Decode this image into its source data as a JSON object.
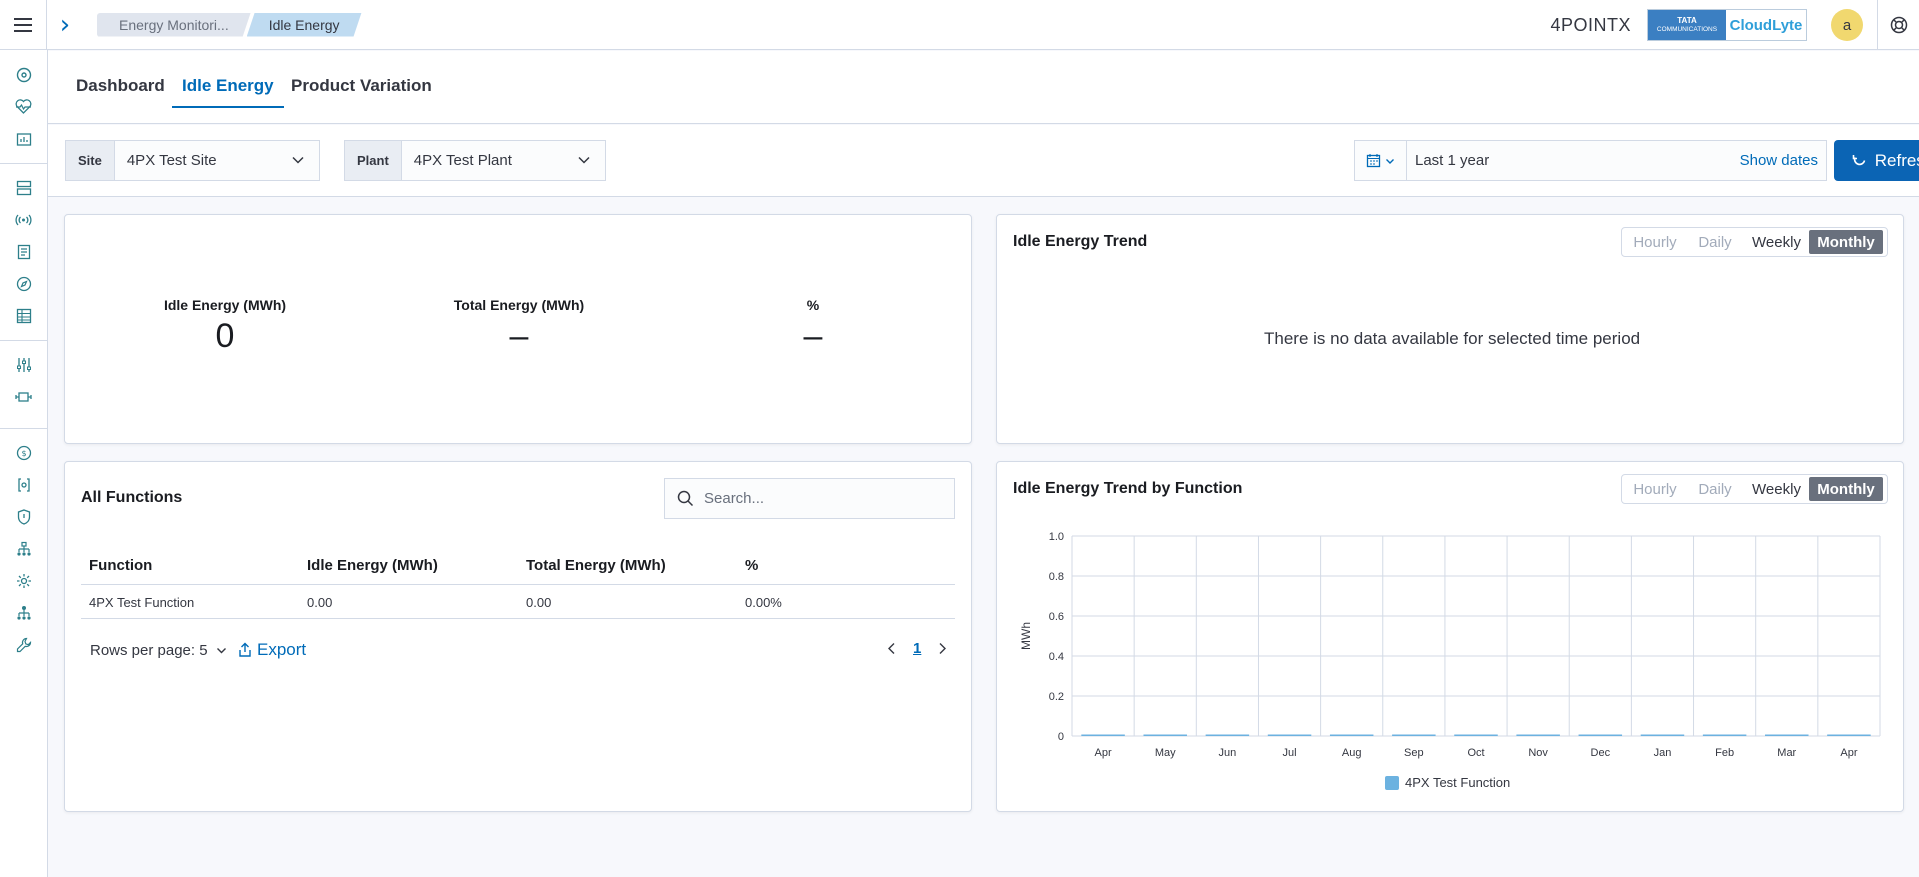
{
  "breadcrumbs": [
    "Energy Monitori...",
    "Idle Energy"
  ],
  "brand": {
    "name_4px": "4POINTX",
    "tata_line1": "TATA",
    "tata_line2": "COMMUNICATIONS",
    "cloud_label": "CloudLyte"
  },
  "user": {
    "initial": "a"
  },
  "tabs": [
    {
      "label": "Dashboard",
      "active": false
    },
    {
      "label": "Idle Energy",
      "active": true
    },
    {
      "label": "Product Variation",
      "active": false
    }
  ],
  "filters": {
    "site": {
      "label": "Site",
      "value": "4PX Test Site"
    },
    "plant": {
      "label": "Plant",
      "value": "4PX Test Plant"
    },
    "date": {
      "value": "Last 1 year",
      "show_dates": "Show dates"
    },
    "refresh_label": "Refresh"
  },
  "summary": {
    "idle": {
      "label": "Idle Energy (MWh)",
      "value": "0"
    },
    "total": {
      "label": "Total Energy (MWh)",
      "value": "–"
    },
    "percent": {
      "label": "%",
      "value": "–"
    }
  },
  "trend_panel": {
    "title": "Idle Energy Trend",
    "no_data": "There is no data available for selected time period",
    "granularity": [
      "Hourly",
      "Daily",
      "Weekly",
      "Monthly"
    ],
    "selected": "Monthly"
  },
  "functions_panel": {
    "title": "All Functions",
    "search_placeholder": "Search...",
    "columns": [
      "Function",
      "Idle Energy (MWh)",
      "Total Energy (MWh)",
      "%"
    ],
    "rows": [
      [
        "4PX Test Function",
        "0.00",
        "0.00",
        "0.00%"
      ]
    ],
    "rows_per_page": "Rows per page: 5",
    "export_label": "Export",
    "current_page": "1"
  },
  "function_trend_panel": {
    "title": "Idle Energy Trend by Function",
    "granularity": [
      "Hourly",
      "Daily",
      "Weekly",
      "Monthly"
    ],
    "selected": "Monthly"
  },
  "chart_data": {
    "type": "bar",
    "title": "Idle Energy Trend by Function",
    "categories": [
      "Apr",
      "May",
      "Jun",
      "Jul",
      "Aug",
      "Sep",
      "Oct",
      "Nov",
      "Dec",
      "Jan",
      "Feb",
      "Mar",
      "Apr"
    ],
    "series": [
      {
        "name": "4PX Test Function",
        "values": [
          0,
          0,
          0,
          0,
          0,
          0,
          0,
          0,
          0,
          0,
          0,
          0,
          0
        ]
      }
    ],
    "xlabel": "",
    "ylabel": "MWh",
    "ylim": [
      0,
      1.0
    ],
    "yticks": [
      "0",
      "0.2",
      "0.4",
      "0.6",
      "0.8",
      "1.0"
    ],
    "grid": true,
    "legend": "bottom",
    "color": "#6cb2e0"
  },
  "colors": {
    "accent": "#006bb8",
    "primary_button": "#0b64b4",
    "selected_toggle": "#69707d"
  }
}
